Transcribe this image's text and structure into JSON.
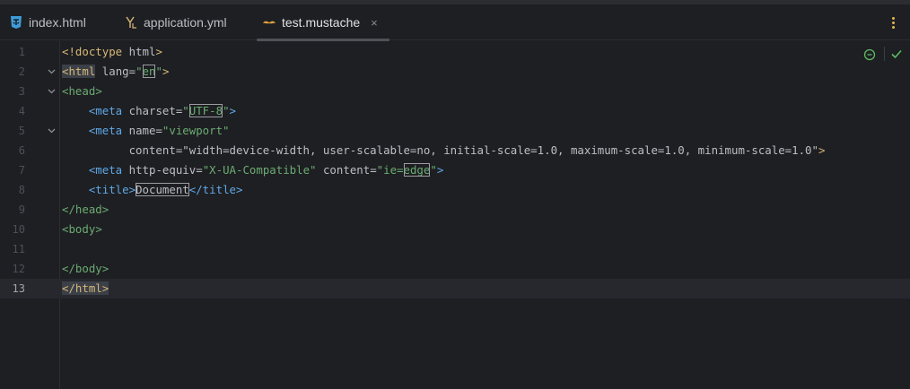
{
  "tabs": [
    {
      "label": "index.html",
      "icon": "html-file-icon",
      "active": false
    },
    {
      "label": "application.yml",
      "icon": "yaml-file-icon",
      "active": false
    },
    {
      "label": "test.mustache",
      "icon": "mustache-file-icon",
      "active": true
    }
  ],
  "close_glyph": "×",
  "colors": {
    "tag": "#d5b778",
    "tag_blue": "#5fa8e8",
    "string": "#6aab73",
    "text": "#bcbec4",
    "background": "#1e1f22"
  },
  "editor": {
    "current_line": 13,
    "lines": [
      {
        "n": "1",
        "text": "<!doctype html>"
      },
      {
        "n": "2",
        "text": "<html lang=\"en\">"
      },
      {
        "n": "3",
        "text": "<head>"
      },
      {
        "n": "4",
        "text": "    <meta charset=\"UTF-8\">"
      },
      {
        "n": "5",
        "text": "    <meta name=\"viewport\""
      },
      {
        "n": "6",
        "text": "          content=\"width=device-width, user-scalable=no, initial-scale=1.0, maximum-scale=1.0, minimum-scale=1.0\">"
      },
      {
        "n": "7",
        "text": "    <meta http-equiv=\"X-UA-Compatible\" content=\"ie=edge\">"
      },
      {
        "n": "8",
        "text": "    <title>Document</title>"
      },
      {
        "n": "9",
        "text": "</head>"
      },
      {
        "n": "10",
        "text": "<body>"
      },
      {
        "n": "11",
        "text": ""
      },
      {
        "n": "12",
        "text": "</body>"
      },
      {
        "n": "13",
        "text": "</html>"
      }
    ]
  },
  "toolbar": {
    "inspection_icon": "no-problems-icon",
    "check_icon": "checkmark-icon"
  }
}
